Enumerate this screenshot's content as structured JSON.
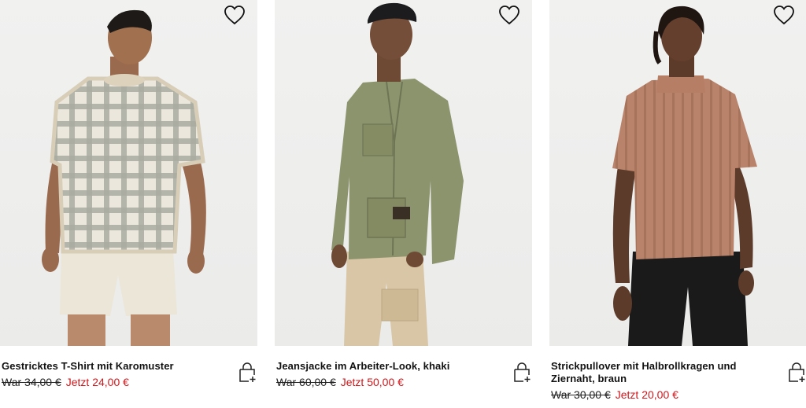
{
  "products": [
    {
      "title": "Gestricktes T-Shirt mit Karomuster",
      "was_price": "War 34,00 €",
      "now_price": "Jetzt 24,00 €"
    },
    {
      "title": "Jeansjacke im Arbeiter-Look, khaki",
      "was_price": "War 60,00 €",
      "now_price": "Jetzt 50,00 €"
    },
    {
      "title": "Strickpullover mit Halbrollkragen und Ziernaht, braun",
      "was_price": "War 30,00 €",
      "now_price": "Jetzt 20,00 €"
    }
  ],
  "icons": {
    "favorite": "heart-outline-icon",
    "add_to_bag": "bag-plus-icon"
  },
  "colors": {
    "sale_price": "#d0171b",
    "photo_background": "#eeeeed"
  }
}
